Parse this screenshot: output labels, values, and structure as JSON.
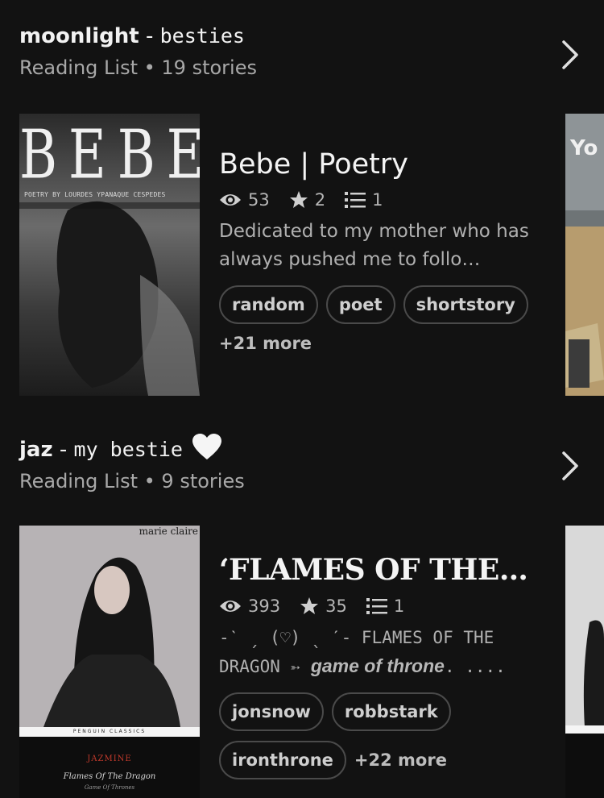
{
  "lists": [
    {
      "owner": "moonlight",
      "separator": " - ",
      "list_name": "besties",
      "subtitle": "Reading List • 19 stories",
      "story": {
        "cover_title": "BEBE",
        "cover_subtitle": "POETRY BY LOURDES YPANAQUE CESPEDES",
        "title": "Bebe | Poetry",
        "reads": "53",
        "votes": "2",
        "parts": "1",
        "description": "Dedicated to my mother who has always pushed me to follo…",
        "tags": [
          "random",
          "poet",
          "shortstory"
        ],
        "more": "+21 more"
      },
      "peek_text": "Yo"
    },
    {
      "owner": "jaz",
      "separator": " - ",
      "list_name": "my bestie",
      "subtitle": "Reading List • 9 stories",
      "story": {
        "cover_brand": "marie claire",
        "cover_publisher": "PENGUIN  CLASSICS",
        "cover_author": "JAZMINE",
        "cover_book": "Flames Of The Dragon",
        "cover_series": "Game Of Thrones",
        "title": "‘FLAMES OF THE…",
        "reads": "393",
        "votes": "35",
        "parts": "1",
        "description_plain": "-ˋ ˏ (♡) ˎ ˊ- FLAMES OF THE DRAGON  ➳",
        "description_emph": "game of throne",
        "description_tail": ". ....",
        "tags": [
          "jonsnow",
          "robbstark",
          "ironthrone"
        ],
        "more": "+22 more"
      }
    }
  ],
  "icons": {
    "heart": "white-heart-icon",
    "chevron": "chevron-right-icon",
    "eye": "eye-icon",
    "star": "star-icon",
    "list": "list-icon"
  },
  "colors": {
    "background": "#121212",
    "tag_border": "#4a4a4a",
    "muted_text": "#a8a8a8"
  }
}
